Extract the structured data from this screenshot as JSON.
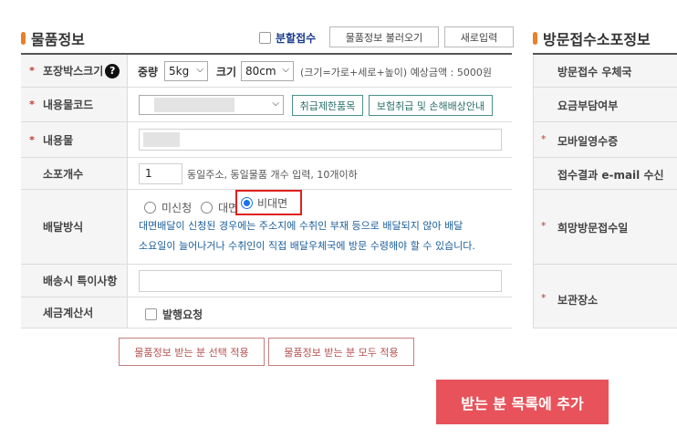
{
  "section_left": {
    "title": "물품정보"
  },
  "section_right": {
    "title": "방문접수소포정보"
  },
  "header": {
    "split_label": "분할접수",
    "load_button": "물품정보 불러오기",
    "new_button": "새로입력"
  },
  "rows": {
    "box_size": {
      "label": "포장박스크기",
      "help": "?",
      "weight_label": "중량",
      "weight_value": "5kg",
      "size_label": "크기",
      "size_value": "80cm",
      "hint": "(크기=가로+세로+높이) 예상금액 : 5000원"
    },
    "content_code": {
      "label": "내용물코드",
      "btn_restricted": "취급제한품목",
      "btn_insurance": "보험취급 및 손해배상안내"
    },
    "content": {
      "label": "내용물"
    },
    "count": {
      "label": "소포개수",
      "value": "1",
      "hint": "동일주소, 동일물품 개수 입력, 10개이하"
    },
    "delivery": {
      "label": "배달방식",
      "opt1": "미신청",
      "opt2": "대면",
      "opt3": "비대면",
      "selected": "비대면",
      "note_line1": "대면배달이 신청된 경우에는 주소지에 수취인 부재 등으로 배달되지 않아 배달",
      "note_line2": "소요일이 늘어나거나 수취인이 직접 배달우체국에 방문 수령해야 할 수 있습니다."
    },
    "special": {
      "label": "배송시 특이사항"
    },
    "tax": {
      "label": "세금계산서",
      "checkbox_label": "발행요청"
    }
  },
  "right_rows": [
    {
      "label": "방문접수 우체국",
      "required": false
    },
    {
      "label": "요금부담여부",
      "required": false
    },
    {
      "label": "모바일영수증",
      "required": true
    },
    {
      "label": "접수결과 e-mail 수신",
      "required": false
    },
    {
      "label": "희망방문접수일",
      "required": true
    },
    {
      "label": "보관장소",
      "required": true
    }
  ],
  "actions": {
    "apply_selected": "물품정보 받는 분 선택 적용",
    "apply_all": "물품정보 받는 분 모두 적용",
    "add_to_list": "받는 분 목록에 추가"
  },
  "colors": {
    "accent_orange": "#e8802c",
    "required_red": "#c0392b",
    "teal_button": "#2a6f6a",
    "note_blue": "#1b5e9b",
    "primary_red": "#e8525a",
    "highlight_box": "#e02020"
  },
  "icons": {
    "help": "question-circle-icon",
    "select_arrow": "chevron-down-icon"
  }
}
